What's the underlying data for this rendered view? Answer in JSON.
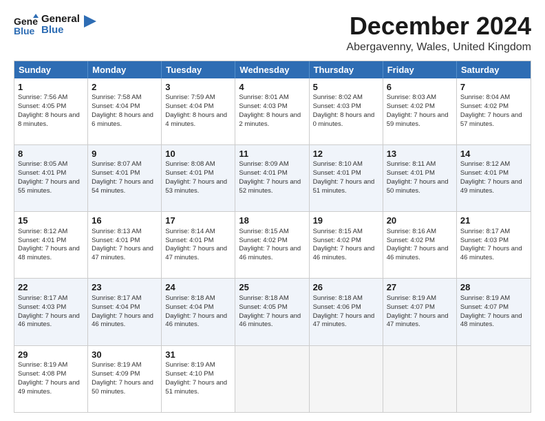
{
  "logo": {
    "line1": "General",
    "line2": "Blue"
  },
  "title": "December 2024",
  "subtitle": "Abergavenny, Wales, United Kingdom",
  "days": [
    "Sunday",
    "Monday",
    "Tuesday",
    "Wednesday",
    "Thursday",
    "Friday",
    "Saturday"
  ],
  "weeks": [
    [
      {
        "num": "1",
        "rise": "7:56 AM",
        "set": "4:05 PM",
        "daylight": "8 hours and 8 minutes."
      },
      {
        "num": "2",
        "rise": "7:58 AM",
        "set": "4:04 PM",
        "daylight": "8 hours and 6 minutes."
      },
      {
        "num": "3",
        "rise": "7:59 AM",
        "set": "4:04 PM",
        "daylight": "8 hours and 4 minutes."
      },
      {
        "num": "4",
        "rise": "8:01 AM",
        "set": "4:03 PM",
        "daylight": "8 hours and 2 minutes."
      },
      {
        "num": "5",
        "rise": "8:02 AM",
        "set": "4:03 PM",
        "daylight": "8 hours and 0 minutes."
      },
      {
        "num": "6",
        "rise": "8:03 AM",
        "set": "4:02 PM",
        "daylight": "7 hours and 59 minutes."
      },
      {
        "num": "7",
        "rise": "8:04 AM",
        "set": "4:02 PM",
        "daylight": "7 hours and 57 minutes."
      }
    ],
    [
      {
        "num": "8",
        "rise": "8:05 AM",
        "set": "4:01 PM",
        "daylight": "7 hours and 55 minutes."
      },
      {
        "num": "9",
        "rise": "8:07 AM",
        "set": "4:01 PM",
        "daylight": "7 hours and 54 minutes."
      },
      {
        "num": "10",
        "rise": "8:08 AM",
        "set": "4:01 PM",
        "daylight": "7 hours and 53 minutes."
      },
      {
        "num": "11",
        "rise": "8:09 AM",
        "set": "4:01 PM",
        "daylight": "7 hours and 52 minutes."
      },
      {
        "num": "12",
        "rise": "8:10 AM",
        "set": "4:01 PM",
        "daylight": "7 hours and 51 minutes."
      },
      {
        "num": "13",
        "rise": "8:11 AM",
        "set": "4:01 PM",
        "daylight": "7 hours and 50 minutes."
      },
      {
        "num": "14",
        "rise": "8:12 AM",
        "set": "4:01 PM",
        "daylight": "7 hours and 49 minutes."
      }
    ],
    [
      {
        "num": "15",
        "rise": "8:12 AM",
        "set": "4:01 PM",
        "daylight": "7 hours and 48 minutes."
      },
      {
        "num": "16",
        "rise": "8:13 AM",
        "set": "4:01 PM",
        "daylight": "7 hours and 47 minutes."
      },
      {
        "num": "17",
        "rise": "8:14 AM",
        "set": "4:01 PM",
        "daylight": "7 hours and 47 minutes."
      },
      {
        "num": "18",
        "rise": "8:15 AM",
        "set": "4:02 PM",
        "daylight": "7 hours and 46 minutes."
      },
      {
        "num": "19",
        "rise": "8:15 AM",
        "set": "4:02 PM",
        "daylight": "7 hours and 46 minutes."
      },
      {
        "num": "20",
        "rise": "8:16 AM",
        "set": "4:02 PM",
        "daylight": "7 hours and 46 minutes."
      },
      {
        "num": "21",
        "rise": "8:17 AM",
        "set": "4:03 PM",
        "daylight": "7 hours and 46 minutes."
      }
    ],
    [
      {
        "num": "22",
        "rise": "8:17 AM",
        "set": "4:03 PM",
        "daylight": "7 hours and 46 minutes."
      },
      {
        "num": "23",
        "rise": "8:17 AM",
        "set": "4:04 PM",
        "daylight": "7 hours and 46 minutes."
      },
      {
        "num": "24",
        "rise": "8:18 AM",
        "set": "4:04 PM",
        "daylight": "7 hours and 46 minutes."
      },
      {
        "num": "25",
        "rise": "8:18 AM",
        "set": "4:05 PM",
        "daylight": "7 hours and 46 minutes."
      },
      {
        "num": "26",
        "rise": "8:18 AM",
        "set": "4:06 PM",
        "daylight": "7 hours and 47 minutes."
      },
      {
        "num": "27",
        "rise": "8:19 AM",
        "set": "4:07 PM",
        "daylight": "7 hours and 47 minutes."
      },
      {
        "num": "28",
        "rise": "8:19 AM",
        "set": "4:07 PM",
        "daylight": "7 hours and 48 minutes."
      }
    ],
    [
      {
        "num": "29",
        "rise": "8:19 AM",
        "set": "4:08 PM",
        "daylight": "7 hours and 49 minutes."
      },
      {
        "num": "30",
        "rise": "8:19 AM",
        "set": "4:09 PM",
        "daylight": "7 hours and 50 minutes."
      },
      {
        "num": "31",
        "rise": "8:19 AM",
        "set": "4:10 PM",
        "daylight": "7 hours and 51 minutes."
      },
      null,
      null,
      null,
      null
    ]
  ]
}
